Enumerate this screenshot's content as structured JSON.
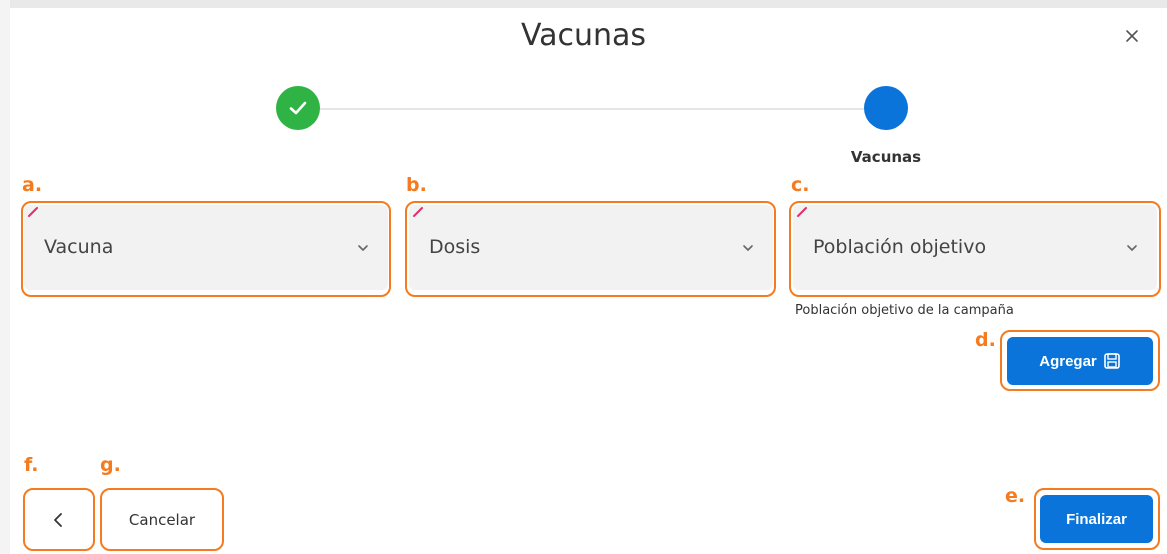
{
  "dialog": {
    "title": "Vacunas",
    "close_icon": "close-icon"
  },
  "stepper": {
    "steps": [
      {
        "label": "",
        "status": "completed",
        "color": "#2fb344"
      },
      {
        "label": "Vacunas",
        "status": "active",
        "color": "#0a74da"
      }
    ]
  },
  "form": {
    "vacuna": {
      "placeholder": "Vacuna",
      "required": true
    },
    "dosis": {
      "placeholder": "Dosis",
      "required": true
    },
    "poblacion": {
      "placeholder": "Población objetivo",
      "required": true,
      "hint": "Población objetivo de la campaña"
    }
  },
  "actions": {
    "agregar_label": "Agregar",
    "agregar_icon": "save-icon",
    "finalizar_label": "Finalizar",
    "back_icon": "chevron-left-icon",
    "cancelar_label": "Cancelar"
  },
  "annotations": {
    "a": "a.",
    "b": "b.",
    "c": "c.",
    "d": "d.",
    "e": "e.",
    "f": "f.",
    "g": "g."
  },
  "colors": {
    "primary": "#0a74da",
    "success": "#2fb344",
    "annotation": "#f47b20",
    "required_marker": "#e0306e"
  }
}
